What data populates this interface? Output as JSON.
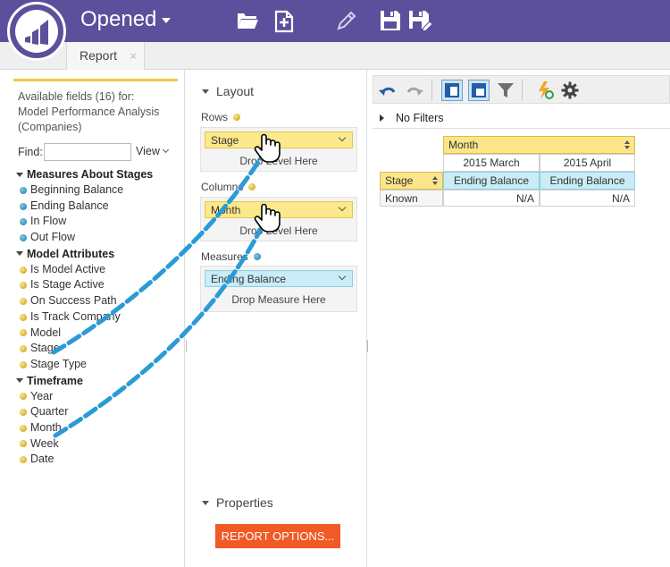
{
  "header": {
    "app_title": "Opened",
    "icons": [
      "folder-open-icon",
      "new-report-icon",
      "pencil-icon",
      "save-icon",
      "save-as-icon"
    ]
  },
  "tabs": [
    {
      "label": "Report",
      "close": "×"
    }
  ],
  "left_panel": {
    "available_line1": "Available fields (16) for:",
    "available_line2": "Model Performance Analysis (Companies)",
    "find_label": "Find:",
    "find_value": "",
    "view_label": "View",
    "groups": [
      {
        "label": "Measures About Stages",
        "fields": [
          {
            "label": "Beginning Balance",
            "color": "blue"
          },
          {
            "label": "Ending Balance",
            "color": "blue"
          },
          {
            "label": "In Flow",
            "color": "blue"
          },
          {
            "label": "Out Flow",
            "color": "blue"
          }
        ]
      },
      {
        "label": "Model Attributes",
        "fields": [
          {
            "label": "Is Model Active",
            "color": "gold"
          },
          {
            "label": "Is Stage Active",
            "color": "gold"
          },
          {
            "label": "On Success Path",
            "color": "gold"
          },
          {
            "label": "Is Track Company",
            "color": "gold"
          },
          {
            "label": "Model",
            "color": "gold"
          },
          {
            "label": "Stage",
            "color": "gold"
          },
          {
            "label": "Stage Type",
            "color": "gold"
          }
        ]
      },
      {
        "label": "Timeframe",
        "fields": [
          {
            "label": "Year",
            "color": "gold"
          },
          {
            "label": "Quarter",
            "color": "gold"
          },
          {
            "label": "Month",
            "color": "gold"
          },
          {
            "label": "Week",
            "color": "gold"
          },
          {
            "label": "Date",
            "color": "gold"
          }
        ]
      }
    ]
  },
  "layout_panel": {
    "layout_label": "Layout",
    "rows_label": "Rows",
    "rows_pill": "Stage",
    "rows_drop": "Drop Level Here",
    "columns_label": "Columns",
    "columns_pill": "Month",
    "columns_drop": "Drop Level Here",
    "measures_label": "Measures",
    "measures_pill": "Ending Balance",
    "measures_drop": "Drop Measure Here",
    "properties_label": "Properties",
    "report_options_button": "REPORT OPTIONS..."
  },
  "report_panel": {
    "toolbar_icons": [
      "undo-icon",
      "redo-icon",
      "layout-rows-icon",
      "layout-columns-icon",
      "filter-icon",
      "refresh-icon",
      "settings-icon"
    ],
    "filters_label": "No Filters",
    "grid": {
      "column_header": "Month",
      "row_header": "Stage",
      "columns": [
        "2015 March",
        "2015 April"
      ],
      "measure_headers": [
        "Ending Balance",
        "Ending Balance"
      ],
      "rows": [
        {
          "label": "Known",
          "values": [
            "N/A",
            "N/A"
          ]
        }
      ]
    }
  },
  "colors": {
    "header_bg": "#5c4f9b",
    "accent_orange": "#f15a24",
    "dimension_yellow": "#fbe98c",
    "measure_cyan": "#c9ecf7",
    "arrow_blue": "#2a9bd6"
  }
}
